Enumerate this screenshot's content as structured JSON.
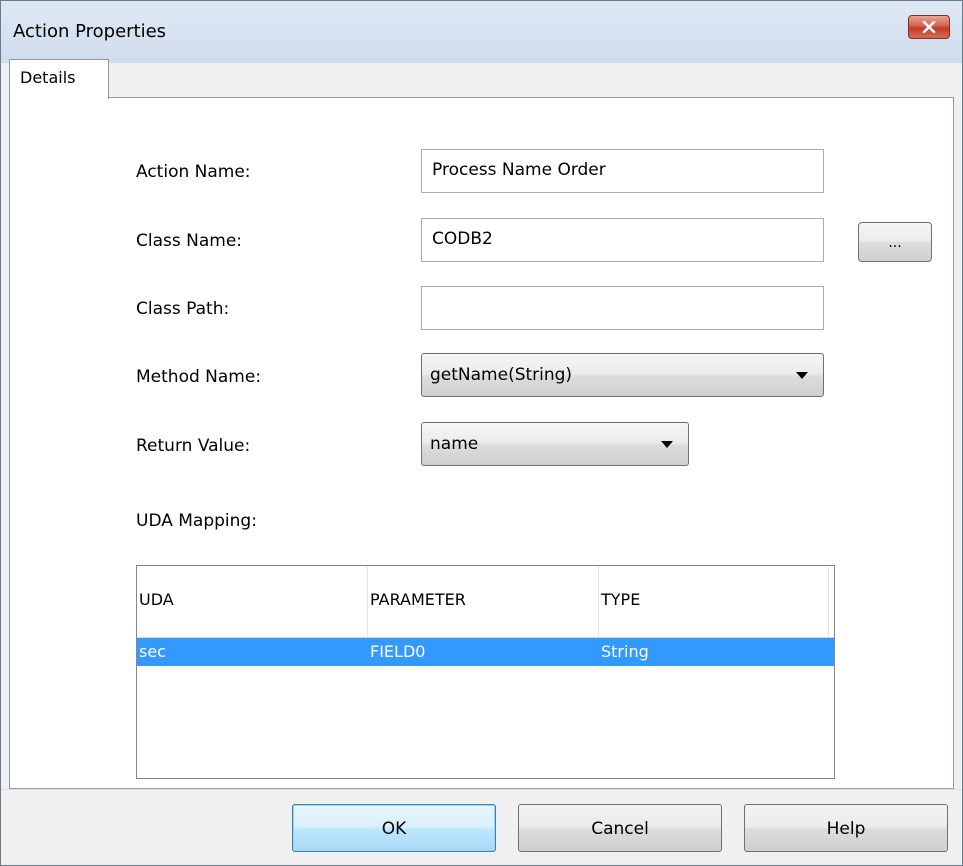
{
  "window": {
    "title": "Action Properties",
    "close_icon": "close-icon"
  },
  "tabs": [
    {
      "label": "Details",
      "active": true
    }
  ],
  "form": {
    "action_name": {
      "label": "Action Name:",
      "value": "Process Name Order"
    },
    "class_name": {
      "label": "Class Name:",
      "value": "CODB2",
      "browse_label": "..."
    },
    "class_path": {
      "label": "Class Path:",
      "value": ""
    },
    "method_name": {
      "label": "Method Name:",
      "value": "getName(String)"
    },
    "return_value": {
      "label": "Return Value:",
      "value": "name"
    },
    "uda_mapping_label": "UDA Mapping:"
  },
  "uda_table": {
    "columns": [
      "UDA",
      "PARAMETER",
      "TYPE"
    ],
    "rows": [
      {
        "uda": "sec",
        "parameter": "FIELD0",
        "type": "String",
        "selected": true
      }
    ]
  },
  "buttons": {
    "ok": "OK",
    "cancel": "Cancel",
    "help": "Help"
  },
  "colors": {
    "selection": "#3399ff",
    "close_button": "#c13c26",
    "titlebar": "#d6e3f1"
  }
}
